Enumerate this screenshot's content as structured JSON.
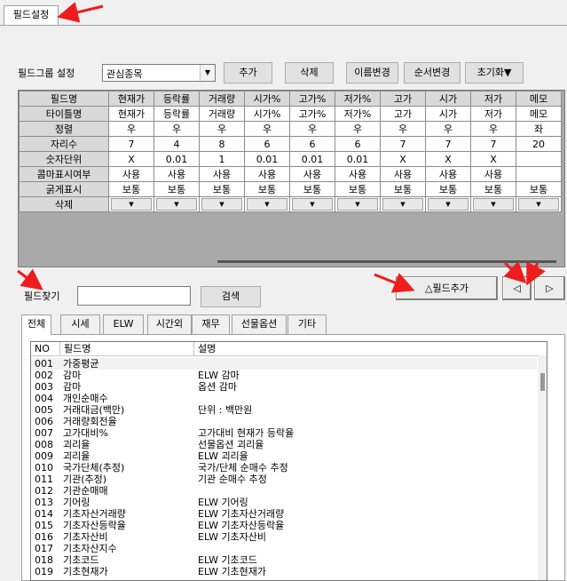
{
  "top_tab": {
    "label": "필드설정"
  },
  "toolbar": {
    "group_label": "필드그룹 설정",
    "group_value": "관심종목",
    "buttons": [
      "추가",
      "삭제",
      "이름변경",
      "순서변경",
      "초기화▼"
    ]
  },
  "grid": {
    "row_headers": [
      "필드명",
      "타이틀명",
      "정렬",
      "자리수",
      "숫자단위",
      "콤마표시여부",
      "굵게표시",
      "삭제"
    ],
    "columns": [
      {
        "field": "현재가",
        "title": "현재가",
        "align": "우",
        "digits": "7",
        "unit": "X",
        "comma": "사용",
        "bold": "보통"
      },
      {
        "field": "등락률",
        "title": "등락률",
        "align": "우",
        "digits": "4",
        "unit": "0.01",
        "comma": "사용",
        "bold": "보통"
      },
      {
        "field": "거래량",
        "title": "거래량",
        "align": "우",
        "digits": "8",
        "unit": "1",
        "comma": "사용",
        "bold": "보통"
      },
      {
        "field": "시가%",
        "title": "시가%",
        "align": "우",
        "digits": "6",
        "unit": "0.01",
        "comma": "사용",
        "bold": "보통"
      },
      {
        "field": "고가%",
        "title": "고가%",
        "align": "우",
        "digits": "6",
        "unit": "0.01",
        "comma": "사용",
        "bold": "보통"
      },
      {
        "field": "저가%",
        "title": "저가%",
        "align": "우",
        "digits": "6",
        "unit": "0.01",
        "comma": "사용",
        "bold": "보통"
      },
      {
        "field": "고가",
        "title": "고가",
        "align": "우",
        "digits": "7",
        "unit": "X",
        "comma": "사용",
        "bold": "보통"
      },
      {
        "field": "시가",
        "title": "시가",
        "align": "우",
        "digits": "7",
        "unit": "X",
        "comma": "사용",
        "bold": "보통"
      },
      {
        "field": "저가",
        "title": "저가",
        "align": "우",
        "digits": "7",
        "unit": "X",
        "comma": "사용",
        "bold": "보통"
      },
      {
        "field": "메모",
        "title": "메모",
        "align": "좌",
        "digits": "20",
        "unit": "",
        "comma": "",
        "bold": "보통"
      }
    ]
  },
  "search": {
    "label": "필드찾기",
    "value": "",
    "button": "검색"
  },
  "field_add": {
    "button": "△필드추가",
    "prev": "◁",
    "next": "▷"
  },
  "tabs": [
    "전체",
    "시세",
    "ELW",
    "시간외",
    "재무",
    "선물옵션",
    "기타"
  ],
  "list": {
    "headers": [
      "NO",
      "필드명",
      "설명"
    ],
    "rows": [
      {
        "no": "001",
        "name": "가중평균",
        "desc": ""
      },
      {
        "no": "002",
        "name": "감마",
        "desc": "ELW 감마"
      },
      {
        "no": "003",
        "name": "감마",
        "desc": "옵션 감마"
      },
      {
        "no": "004",
        "name": "개인순매수",
        "desc": ""
      },
      {
        "no": "005",
        "name": "거래대금(백만)",
        "desc": "단위 : 백만원"
      },
      {
        "no": "006",
        "name": "거래량회전율",
        "desc": ""
      },
      {
        "no": "007",
        "name": "고가대비%",
        "desc": "고가대비 현재가 등락율"
      },
      {
        "no": "008",
        "name": "괴리율",
        "desc": "선물옵션 괴리율"
      },
      {
        "no": "009",
        "name": "괴리율",
        "desc": "ELW 괴리율"
      },
      {
        "no": "010",
        "name": "국가단체(추정)",
        "desc": "국가/단체 순매수 추정"
      },
      {
        "no": "011",
        "name": "기관(추정)",
        "desc": "기관 순매수 추정"
      },
      {
        "no": "012",
        "name": "기관순매매",
        "desc": ""
      },
      {
        "no": "013",
        "name": "기어링",
        "desc": "ELW 기어링"
      },
      {
        "no": "014",
        "name": "기초자산거래량",
        "desc": "ELW 기초자산거래량"
      },
      {
        "no": "015",
        "name": "기초자산등락율",
        "desc": "ELW 기초자산등락율"
      },
      {
        "no": "016",
        "name": "기초자산비",
        "desc": "ELW 기초자산비"
      },
      {
        "no": "017",
        "name": "기초자산지수",
        "desc": ""
      },
      {
        "no": "018",
        "name": "기초코드",
        "desc": "ELW 기초코드"
      },
      {
        "no": "019",
        "name": "기초현재가",
        "desc": "ELW 기초현재가"
      }
    ]
  },
  "colors": {
    "annotation_arrow": "#ee1c1c",
    "grid_header": "#d9d9d9",
    "grid_bg": "#a9a9a9"
  }
}
